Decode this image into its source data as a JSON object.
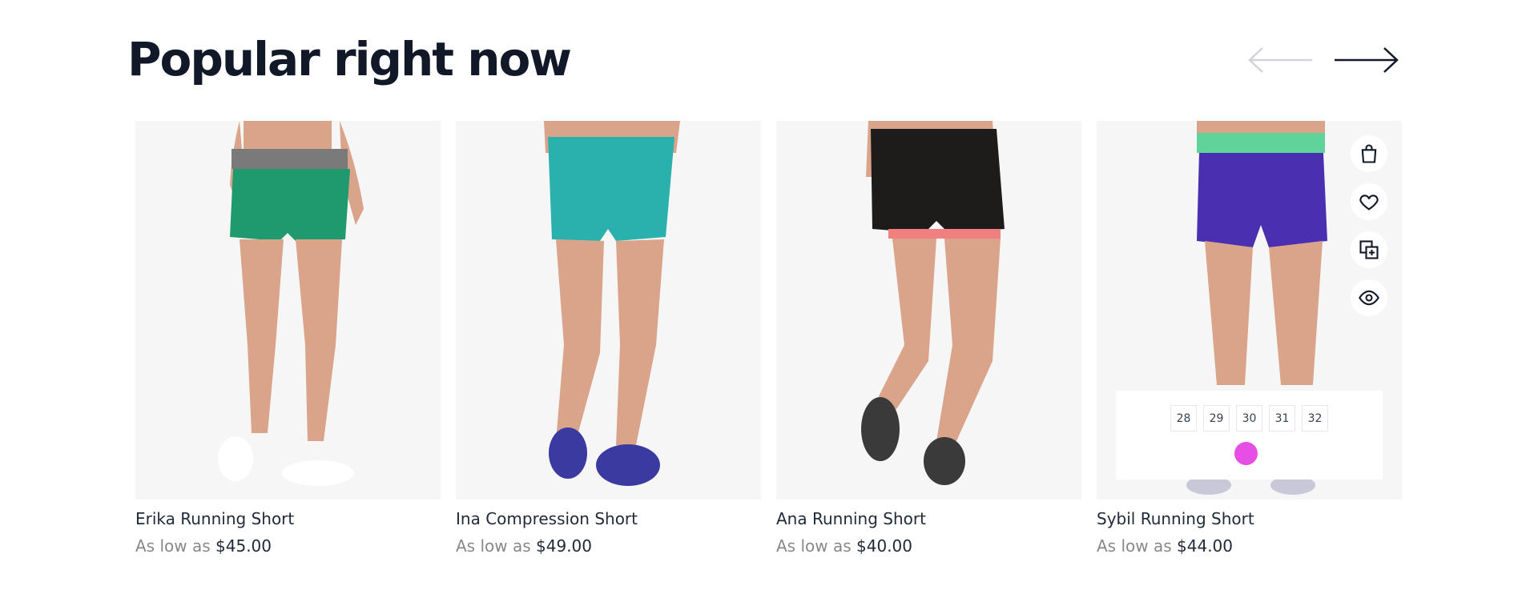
{
  "section": {
    "title": "Popular right now"
  },
  "carousel": {
    "prev_label": "Previous",
    "next_label": "Next"
  },
  "products": [
    {
      "name": "Erika Running Short",
      "price_prefix": "As low as",
      "price": "$45.00",
      "shorts_color": "#1f9a6e",
      "waist_color": "#7a7a7a"
    },
    {
      "name": "Ina Compression Short",
      "price_prefix": "As low as",
      "price": "$49.00",
      "shorts_color": "#2ab0ad",
      "waist_color": "#2ab0ad"
    },
    {
      "name": "Ana Running Short",
      "price_prefix": "As low as",
      "price": "$40.00",
      "shorts_color": "#1e1b1b",
      "waist_color": "#1e1b1b"
    },
    {
      "name": "Sybil Running Short",
      "price_prefix": "As low as",
      "price": "$44.00",
      "shorts_color": "#4a2fb0",
      "waist_color": "#5fd39a",
      "hover": {
        "actions": [
          "shopping-bag-icon",
          "heart-icon",
          "compare-icon",
          "eye-icon"
        ],
        "sizes": [
          "28",
          "29",
          "30",
          "31",
          "32"
        ],
        "color_swatch": "#e64ee6"
      }
    }
  ],
  "colors": {
    "title": "#111827",
    "price_prefix": "#888888",
    "card_bg": "#f6f6f6"
  }
}
